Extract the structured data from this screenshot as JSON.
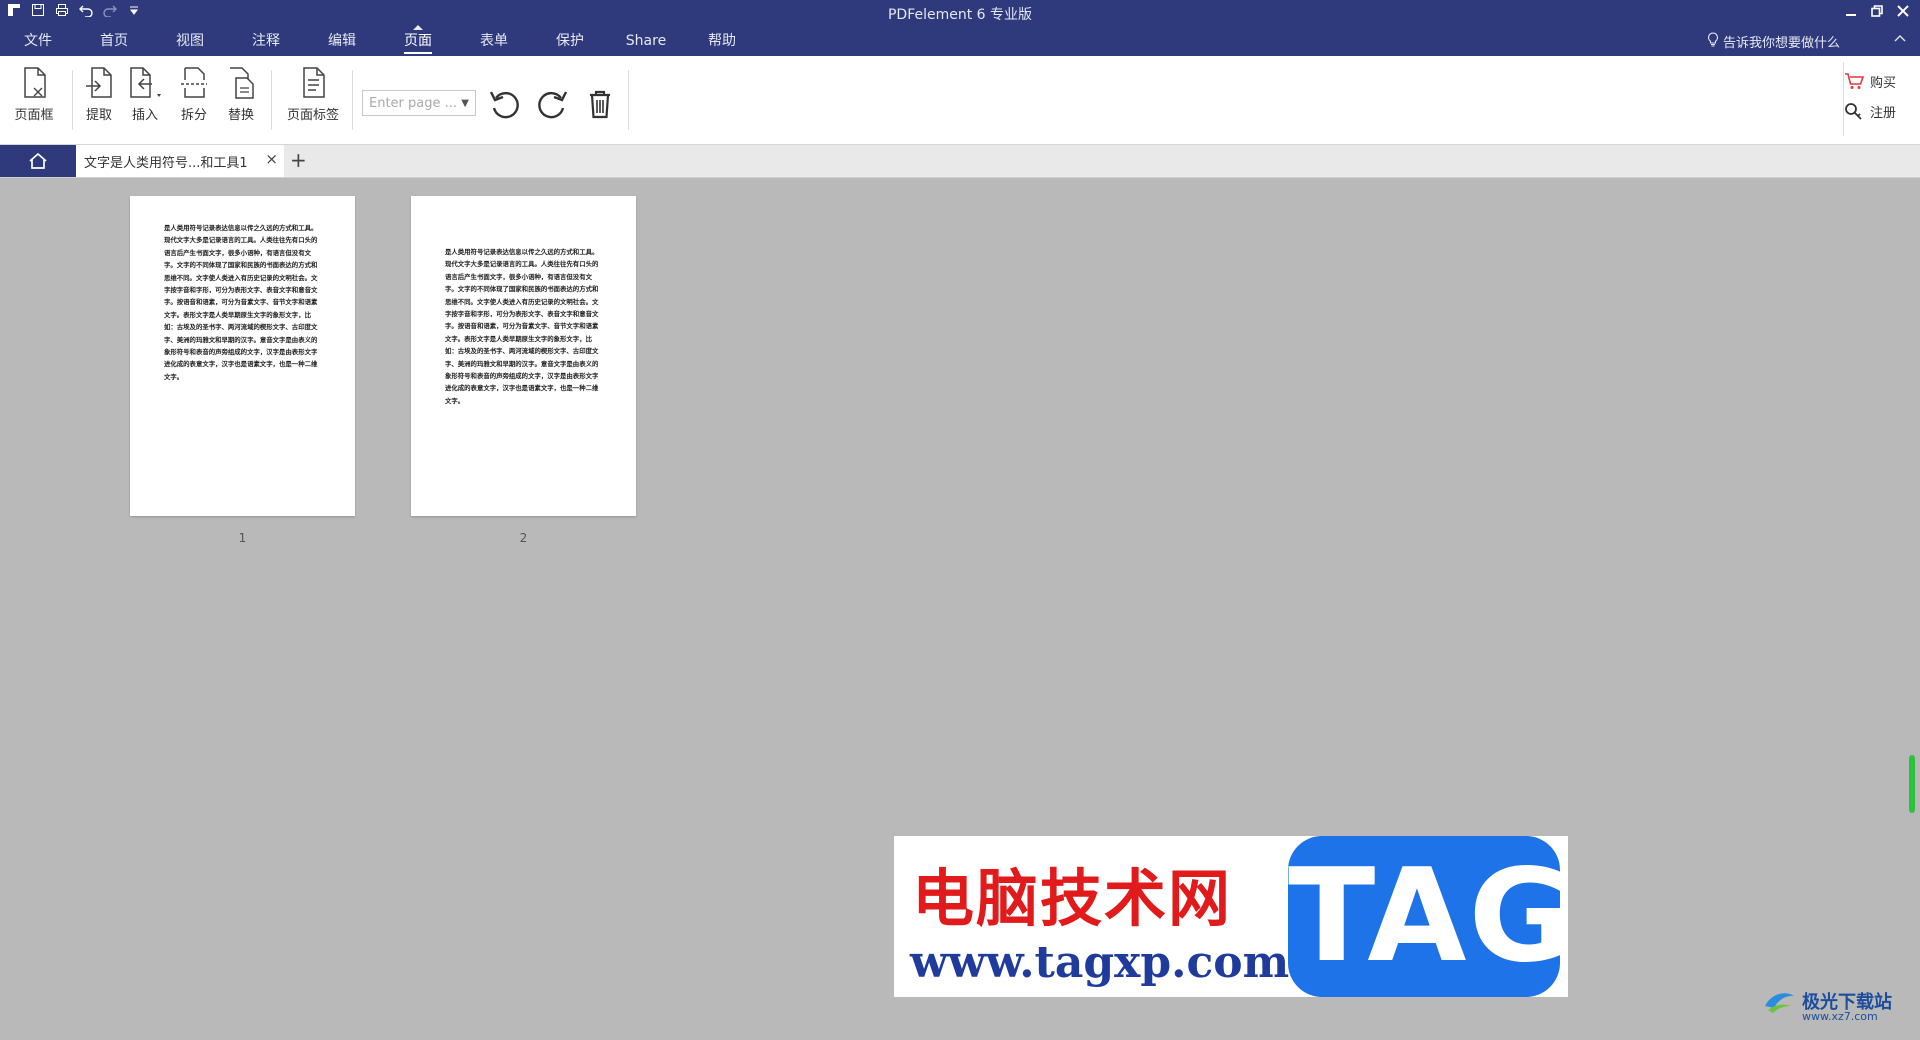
{
  "window": {
    "title": "PDFelement  6 专业版",
    "controls": [
      "minimize-icon",
      "restore-icon",
      "close-icon"
    ]
  },
  "quick_access": [
    "app-logo-icon",
    "save-icon",
    "print-icon",
    "undo-icon",
    "redo-icon",
    "customize-icon"
  ],
  "menu": {
    "items": [
      "文件",
      "首页",
      "视图",
      "注释",
      "编辑",
      "页面",
      "表单",
      "保护",
      "Share",
      "帮助"
    ],
    "active": "页面",
    "tell_me": "告诉我你想要做什么"
  },
  "ribbon": {
    "buttons": [
      {
        "label": "页面框",
        "icon": "page-box-icon"
      },
      {
        "label": "提取",
        "icon": "extract-icon"
      },
      {
        "label": "插入",
        "icon": "insert-icon"
      },
      {
        "label": "拆分",
        "icon": "split-icon"
      },
      {
        "label": "替换",
        "icon": "replace-icon"
      },
      {
        "label": "页面标签",
        "icon": "page-label-icon"
      }
    ],
    "page_input_placeholder": "Enter page ...",
    "actions": [
      "rotate-left-icon",
      "rotate-right-icon",
      "delete-icon"
    ],
    "right": [
      {
        "label": "购买",
        "icon": "cart-icon"
      },
      {
        "label": "注册",
        "icon": "key-icon"
      }
    ]
  },
  "tabs": {
    "home_icon": "home-icon",
    "document_tab": "文字是人类用符号...和工具1",
    "close": "×",
    "add": "+"
  },
  "pages": [
    {
      "number": "1",
      "text": "是人类用符号记录表达信息以传之久远的方式和工具。现代文字大多是记录语言的工具。人类往往先有口头的语言后产生书面文字，很多小语种，有语言但没有文字。文字的不同体现了国家和民族的书面表达的方式和思维不同。文字使人类进入有历史记录的文明社会。文字按字音和字形，可分为表形文字、表音文字和意音文字。按语音和语素，可分为音素文字、音节文字和语素文字。表形文字是人类早期原生文字的象形文字，比如：古埃及的圣书字、两河流域的楔形文字、古印度文字、美洲的玛雅文和早期的汉字。意音文字是由表义的象形符号和表音的声旁组成的文字，汉字是由表形文字进化成的表意文字，汉字也是语素文字，也是一种二维文字。"
    },
    {
      "number": "2",
      "text": "是人类用符号记录表达信息以传之久远的方式和工具。现代文字大多是记录语言的工具。人类往往先有口头的语言后产生书面文字，很多小语种，有语言但没有文字。文字的不同体现了国家和民族的书面表达的方式和思维不同。文字使人类进入有历史记录的文明社会。文字按字音和字形，可分为表形文字、表音文字和意音文字。按语音和语素，可分为音素文字、音节文字和语素文字。表形文字是人类早期原生文字的象形文字，比如：古埃及的圣书字、两河流域的楔形文字、古印度文字、美洲的玛雅文和早期的汉字。意音文字是由表义的象形符号和表音的声旁组成的文字，汉字是由表形文字进化成的表意文字，汉字也是语素文字，也是一种二维文字。"
    }
  ],
  "watermark": {
    "site_name": "电脑技术网",
    "url": "www.tagxp.com",
    "tag": "TAG",
    "corner_name": "极光下载站",
    "corner_url": "www.xz7.com"
  },
  "colors": {
    "title_bar": "#2e3a7c",
    "canvas": "#b9b9b9",
    "scroll_indicator": "#2bc23e",
    "watermark_red": "#e11b1b",
    "watermark_blue": "#1f73e8"
  }
}
